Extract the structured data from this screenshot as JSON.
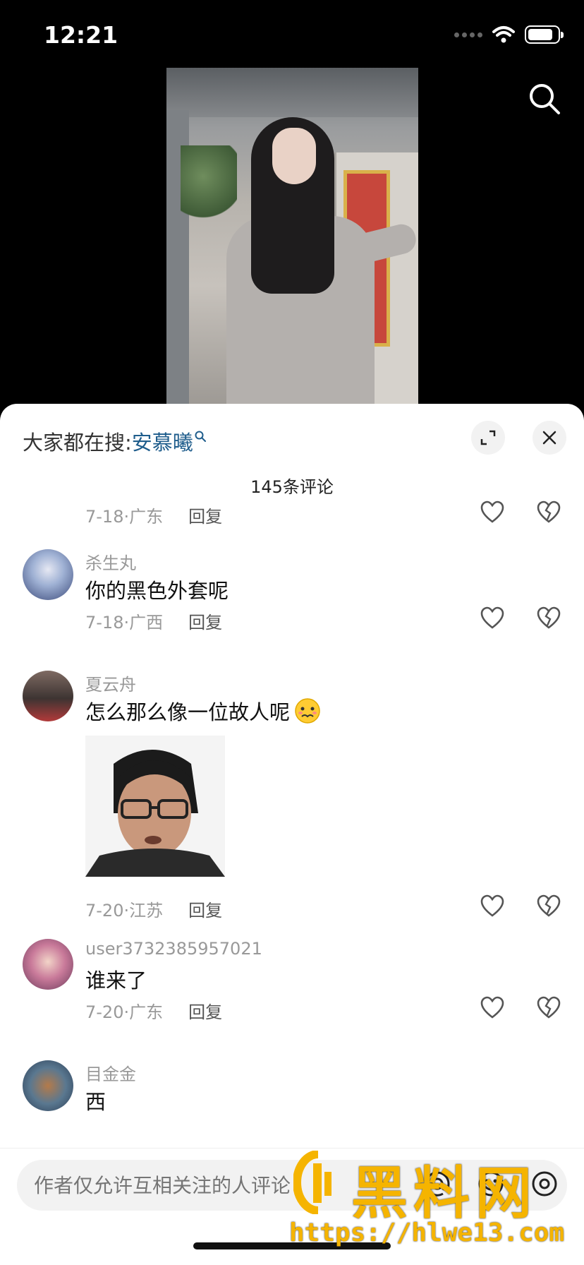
{
  "status_bar": {
    "time": "12:21"
  },
  "header": {
    "hot_search_prefix": "大家都在搜:",
    "hot_search_term": "安慕曦"
  },
  "comment_count": "145条评论",
  "comments": [
    {
      "date_location": "7-18·广东",
      "reply": "回复"
    },
    {
      "username": "杀生丸",
      "text": "你的黑色外套呢",
      "date_location": "7-18·广西",
      "reply": "回复"
    },
    {
      "username": "夏云舟",
      "text": "怎么那么像一位故人呢",
      "date_location": "7-20·江苏",
      "reply": "回复"
    },
    {
      "username": "user3732385957021",
      "text": "谁来了",
      "date_location": "7-20·广东",
      "reply": "回复"
    },
    {
      "username": "目金金",
      "text": "西"
    }
  ],
  "input": {
    "placeholder": "作者仅允许互相关注的人评论"
  },
  "watermark": {
    "brand": "黑料网",
    "url": "https://hlwe13.com"
  },
  "colors": {
    "accent_link": "#1f5d8c",
    "watermark": "#f5b400"
  },
  "icons": [
    "search-icon",
    "expand-icon",
    "close-icon",
    "heart-icon",
    "broken-heart-icon",
    "at-icon",
    "emoji-icon",
    "image-icon"
  ]
}
